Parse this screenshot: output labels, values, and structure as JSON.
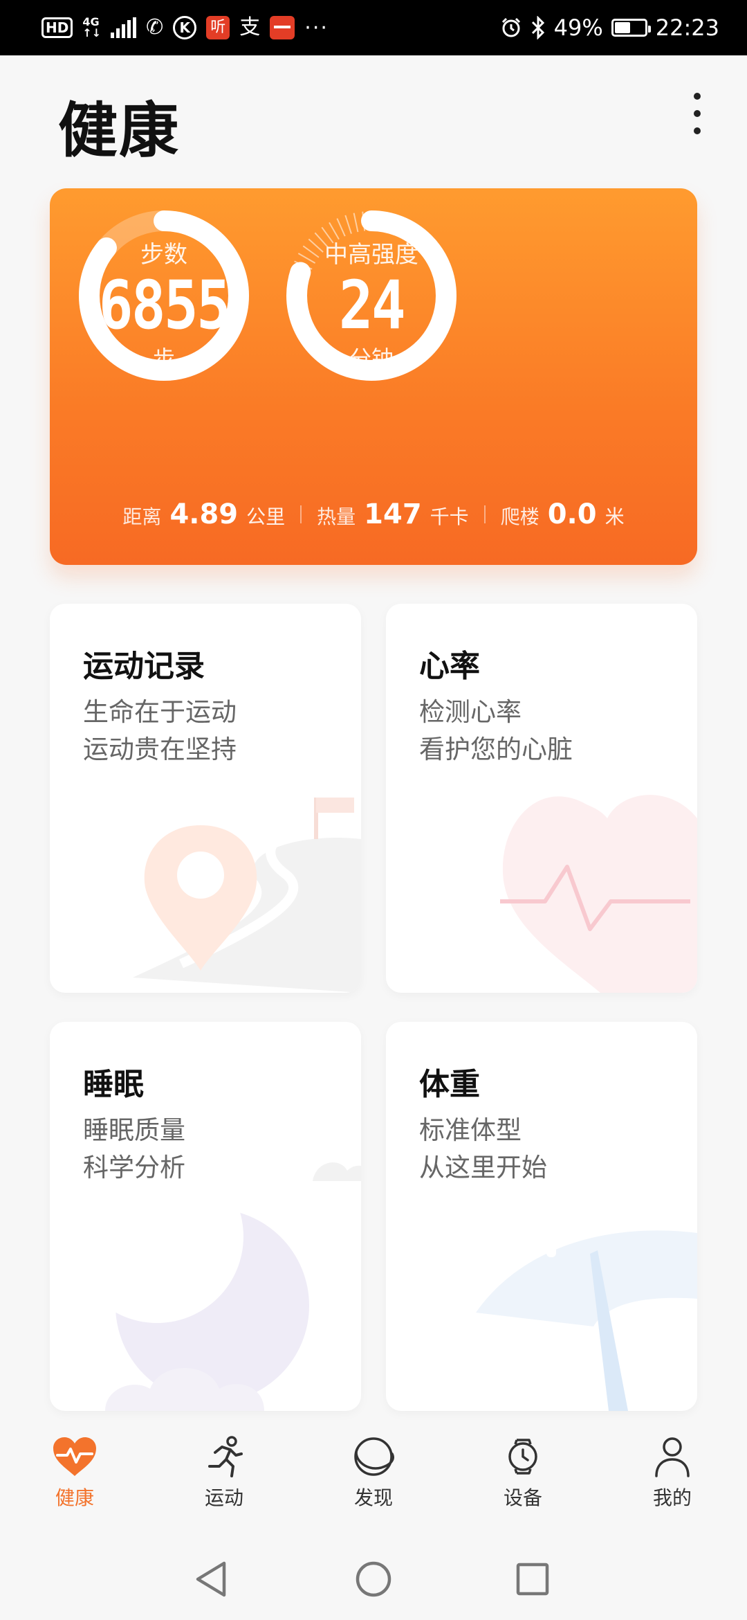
{
  "status_bar": {
    "hd": "HD",
    "network": "4G",
    "app_ting": "听",
    "app_k": "K",
    "app_zhi": "支",
    "more": "···",
    "battery": "49%",
    "battery_level": 0.49,
    "time": "22:23"
  },
  "header": {
    "title": "健康"
  },
  "summary": {
    "steps": {
      "label": "步数",
      "value": "6855",
      "unit": "步",
      "progress": 0.86
    },
    "intensity": {
      "label": "中高强度",
      "value": "24",
      "unit": "分钟",
      "progress": 0.8
    },
    "stats": [
      {
        "label": "距离",
        "value": "4.89",
        "unit": "公里"
      },
      {
        "label": "热量",
        "value": "147",
        "unit": "千卡"
      },
      {
        "label": "爬楼",
        "value": "0.0",
        "unit": "米"
      }
    ],
    "colors": {
      "top": "#ff9b2f",
      "bottom": "#f76a24"
    }
  },
  "cards": [
    {
      "title": "运动记录",
      "line1": "生命在于运动",
      "line2": "运动贵在坚持"
    },
    {
      "title": "心率",
      "line1": "检测心率",
      "line2": "看护您的心脏"
    },
    {
      "title": "睡眠",
      "line1": "睡眠质量",
      "line2": "科学分析"
    },
    {
      "title": "体重",
      "line1": "标准体型",
      "line2": "从这里开始"
    }
  ],
  "bottom_nav": [
    {
      "label": "健康",
      "icon": "heart-pulse-icon",
      "active": true
    },
    {
      "label": "运动",
      "icon": "running-person-icon",
      "active": false
    },
    {
      "label": "发现",
      "icon": "planet-icon",
      "active": false
    },
    {
      "label": "设备",
      "icon": "watch-icon",
      "active": false
    },
    {
      "label": "我的",
      "icon": "person-icon",
      "active": false
    }
  ],
  "accent_color": "#f3732c"
}
